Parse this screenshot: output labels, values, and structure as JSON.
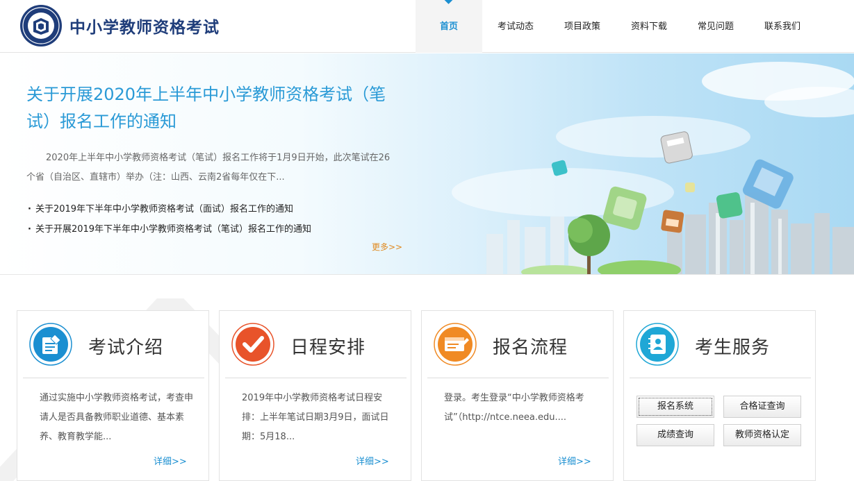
{
  "header": {
    "site_title": "中小学教师资格考试",
    "nav": [
      {
        "label": "首页",
        "active": true
      },
      {
        "label": "考试动态"
      },
      {
        "label": "项目政策"
      },
      {
        "label": "资料下载"
      },
      {
        "label": "常见问题"
      },
      {
        "label": "联系我们"
      }
    ]
  },
  "banner": {
    "headline": "关于开展2020年上半年中小学教师资格考试（笔试）报名工作的通知",
    "summary": "2020年上半年中小学教师资格考试（笔试）报名工作将于1月9日开始，此次笔试在26个省（自治区、直辖市）举办（注：山西、云南2省每年仅在下...",
    "links": [
      "关于2019年下半年中小学教师资格考试（面试）报名工作的通知",
      "关于开展2019年下半年中小学教师资格考试（笔试）报名工作的通知"
    ],
    "more": "更多>>"
  },
  "cards": [
    {
      "title": "考试介绍",
      "icon": "document-edit-icon",
      "text": "通过实施中小学教师资格考试，考查申请人是否具备教师职业道德、基本素养、教育教学能...",
      "more": "详细>>"
    },
    {
      "title": "日程安排",
      "icon": "checkmark-icon",
      "text": "2019年中小学教师资格考试日程安排：上半年笔试日期3月9日，面试日期：5月18...",
      "more": "详细>>"
    },
    {
      "title": "报名流程",
      "icon": "form-edit-icon",
      "text": "登录。考生登录“中小学教师资格考试”（http://ntce.neea.edu....",
      "more": "详细>>"
    },
    {
      "title": "考生服务",
      "icon": "contact-book-icon",
      "buttons": [
        "报名系统",
        "合格证查询",
        "成绩查询",
        "教师资格认定"
      ]
    }
  ],
  "colors": {
    "accent": "#1b8fd1",
    "title_blue": "#1f3d7a",
    "headline": "#2a9ad6",
    "more_orange": "#e0891f",
    "icon_red": "#e8532a",
    "icon_orange": "#f08a24",
    "icon_cyan": "#1fa7d6"
  }
}
